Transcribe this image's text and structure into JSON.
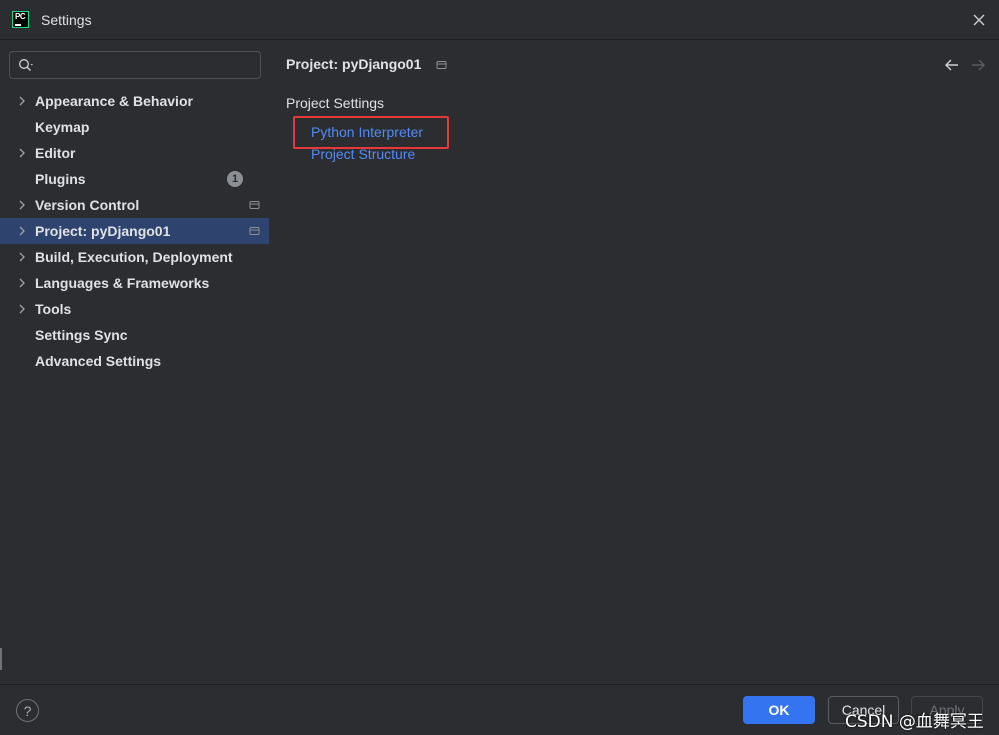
{
  "window": {
    "title": "Settings",
    "app_icon_text": "PC"
  },
  "sidebar": {
    "search": {
      "placeholder": "",
      "value": ""
    },
    "items": [
      {
        "label": "Appearance & Behavior",
        "expandable": true
      },
      {
        "label": "Keymap",
        "expandable": false
      },
      {
        "label": "Editor",
        "expandable": true
      },
      {
        "label": "Plugins",
        "expandable": false,
        "badge": "1"
      },
      {
        "label": "Version Control",
        "expandable": true,
        "scope_icon": true
      },
      {
        "label": "Project: pyDjango01",
        "expandable": true,
        "scope_icon": true,
        "selected": true
      },
      {
        "label": "Build, Execution, Deployment",
        "expandable": true
      },
      {
        "label": "Languages & Frameworks",
        "expandable": true
      },
      {
        "label": "Tools",
        "expandable": true
      },
      {
        "label": "Settings Sync",
        "expandable": false
      },
      {
        "label": "Advanced Settings",
        "expandable": false
      }
    ]
  },
  "main": {
    "title": "Project: pyDjango01",
    "section_label": "Project Settings",
    "links": [
      {
        "label": "Python Interpreter",
        "highlighted": true
      },
      {
        "label": "Project Structure",
        "highlighted": false
      }
    ]
  },
  "footer": {
    "help_label": "?",
    "ok_label": "OK",
    "cancel_label": "Cancel",
    "apply_label": "Apply",
    "watermark": "CSDN @血舞冥王"
  },
  "colors": {
    "background": "#2b2d30",
    "selection": "#2e436e",
    "link": "#548af7",
    "primary_button": "#3574f0",
    "highlight_box": "#e5383b"
  }
}
